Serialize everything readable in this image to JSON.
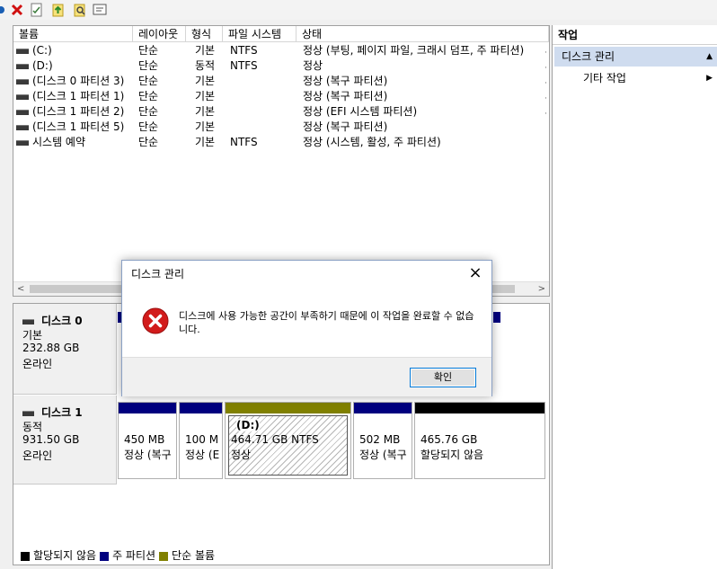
{
  "toolbar": {
    "icons": [
      "back-arrow-icon",
      "delete-icon",
      "properties-icon",
      "up-icon",
      "search-icon",
      "settings-icon"
    ]
  },
  "list": {
    "columns": [
      "볼륨",
      "레이아웃",
      "형식",
      "파일 시스템",
      "상태"
    ],
    "rows": [
      {
        "volume": "(C:)",
        "layout": "단순",
        "type": "기본",
        "fs": "NTFS",
        "status": "정상 (부팅, 페이지 파일, 크래시 덤프, 주 파티션)"
      },
      {
        "volume": "(D:)",
        "layout": "단순",
        "type": "동적",
        "fs": "NTFS",
        "status": "정상"
      },
      {
        "volume": "(디스크 0 파티션 3)",
        "layout": "단순",
        "type": "기본",
        "fs": "",
        "status": "정상 (복구 파티션)"
      },
      {
        "volume": "(디스크 1 파티션 1)",
        "layout": "단순",
        "type": "기본",
        "fs": "",
        "status": "정상 (복구 파티션)"
      },
      {
        "volume": "(디스크 1 파티션 2)",
        "layout": "단순",
        "type": "기본",
        "fs": "",
        "status": "정상 (EFI 시스템 파티션)"
      },
      {
        "volume": "(디스크 1 파티션 5)",
        "layout": "단순",
        "type": "기본",
        "fs": "",
        "status": "정상 (복구 파티션)"
      },
      {
        "volume": "시스템 예약",
        "layout": "단순",
        "type": "기본",
        "fs": "NTFS",
        "status": "정상 (시스템, 활성, 주 파티션)"
      }
    ]
  },
  "disks": [
    {
      "name": "디스크 0",
      "kind": "기본",
      "size": "232.88 GB",
      "state": "온라인"
    },
    {
      "name": "디스크 1",
      "kind": "동적",
      "size": "931.50 GB",
      "state": "온라인",
      "partitions": [
        {
          "label": "",
          "line1": "450 MB",
          "line2": "정상 (복구",
          "bar": "#00007f"
        },
        {
          "label": "",
          "line1": "100 M",
          "line2": "정상 (E",
          "bar": "#00007f"
        },
        {
          "label": "(D:)",
          "line1": "464.71 GB NTFS",
          "line2": "정상",
          "bar": "#808000"
        },
        {
          "label": "",
          "line1": "502 MB",
          "line2": "정상 (복구",
          "bar": "#00007f"
        },
        {
          "label": "",
          "line1": "465.76 GB",
          "line2": "할당되지 않음",
          "bar": "#000000"
        }
      ]
    }
  ],
  "legend": [
    {
      "label": "할당되지 않음",
      "color": "#000000"
    },
    {
      "label": "주 파티션",
      "color": "#00007f"
    },
    {
      "label": "단순 볼륨",
      "color": "#808000"
    }
  ],
  "actions": {
    "title": "작업",
    "section": "디스크 관리",
    "item": "기타 작업"
  },
  "dialog": {
    "title": "디스크 관리",
    "message": "디스크에 사용 가능한 공간이 부족하기 때문에 이 작업을 완료할 수 없습니다.",
    "ok": "확인"
  }
}
